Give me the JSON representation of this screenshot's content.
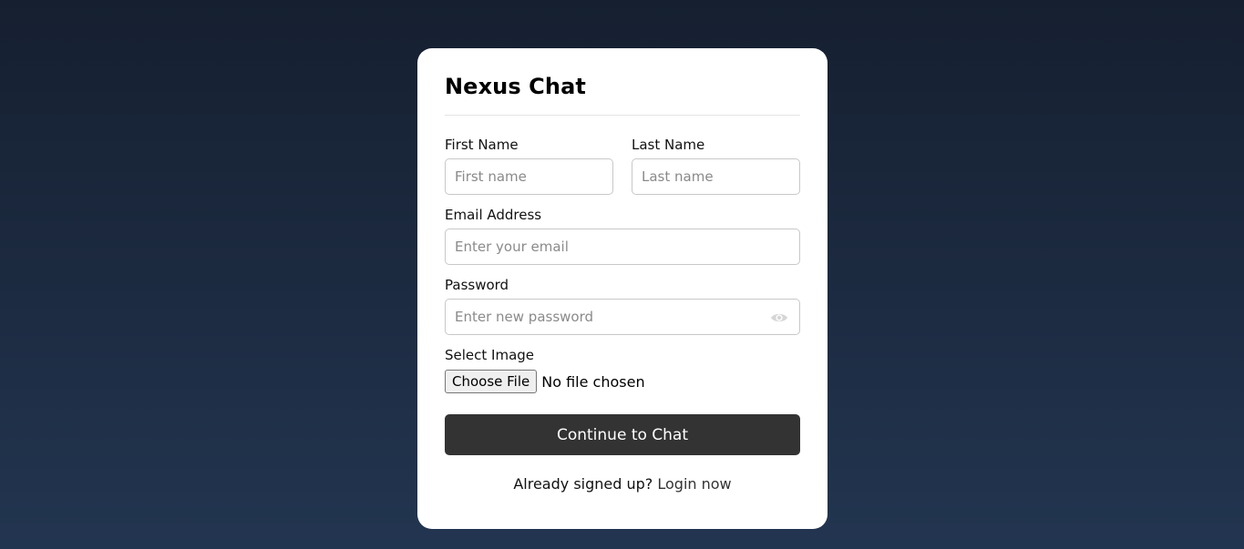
{
  "app": {
    "title": "Nexus Chat"
  },
  "form": {
    "first_name": {
      "label": "First Name",
      "placeholder": "First name",
      "value": ""
    },
    "last_name": {
      "label": "Last Name",
      "placeholder": "Last name",
      "value": ""
    },
    "email": {
      "label": "Email Address",
      "placeholder": "Enter your email",
      "value": ""
    },
    "password": {
      "label": "Password",
      "placeholder": "Enter new password",
      "value": "",
      "toggle_icon": "eye-icon"
    },
    "image": {
      "label": "Select Image",
      "button_label": "Choose File",
      "status": "No file chosen"
    },
    "submit_label": "Continue to Chat"
  },
  "footer": {
    "prompt": "Already signed up?",
    "link_label": "Login now"
  },
  "colors": {
    "background_top": "#151f30",
    "background_bottom": "#223550",
    "card": "#ffffff",
    "button": "#333333"
  }
}
